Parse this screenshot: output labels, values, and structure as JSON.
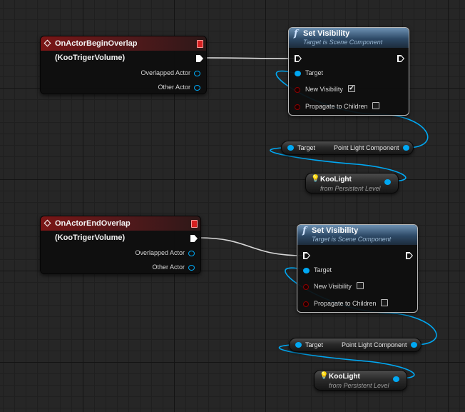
{
  "graph": {
    "top": {
      "event": {
        "title": "OnActorBeginOverlap (KooTrigerVolume)",
        "pins": [
          "Overlapped Actor",
          "Other Actor"
        ]
      },
      "function": {
        "title": "Set Visibility",
        "subtitle": "Target is Scene Component",
        "pins": {
          "target": "Target",
          "new_visibility": "New Visibility",
          "propagate": "Propagate to Children"
        },
        "new_visibility_checked": true,
        "propagate_checked": false
      },
      "getter": {
        "target_label": "Target",
        "output_label": "Point Light Component"
      },
      "variable": {
        "name": "KooLight",
        "subtitle": "from Persistent Level"
      }
    },
    "bottom": {
      "event": {
        "title": "OnActorEndOverlap (KooTrigerVolume)",
        "pins": [
          "Overlapped Actor",
          "Other Actor"
        ]
      },
      "function": {
        "title": "Set Visibility",
        "subtitle": "Target is Scene Component",
        "pins": {
          "target": "Target",
          "new_visibility": "New Visibility",
          "propagate": "Propagate to Children"
        },
        "new_visibility_checked": false,
        "propagate_checked": false
      },
      "getter": {
        "target_label": "Target",
        "output_label": "Point Light Component"
      },
      "variable": {
        "name": "KooLight",
        "subtitle": "from Persistent Level"
      }
    }
  },
  "icons": {
    "event": "event-diamond-icon",
    "function": "function-icon",
    "light": "light-bulb-icon",
    "check": "✔",
    "close": "close-icon"
  },
  "colors": {
    "event_header": "#7a1616",
    "function_header": "#2d4966",
    "object_pin": "#00a8f3",
    "bool_pin": "#8c0000",
    "exec_wire": "#ffffff",
    "object_wire": "#00a8f3"
  }
}
